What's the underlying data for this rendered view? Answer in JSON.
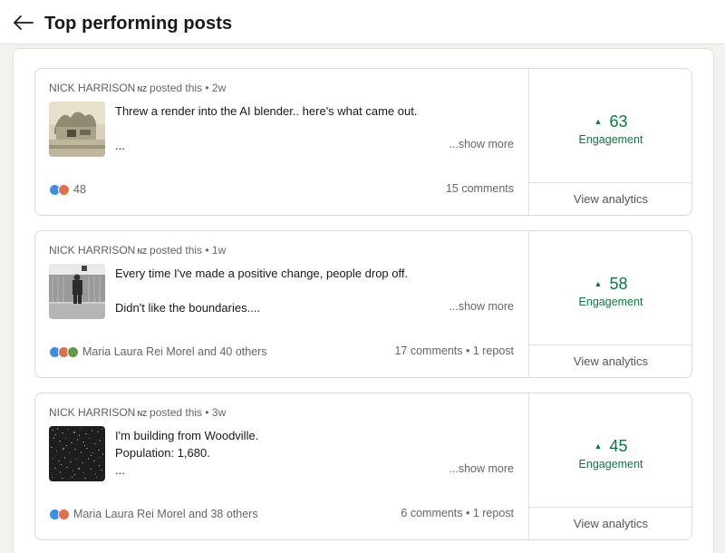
{
  "header": {
    "title": "Top performing posts",
    "back_icon": "arrow-left-icon"
  },
  "colors": {
    "engagement": "#0a7a3e",
    "like": "#378fe9",
    "love": "#df704d",
    "support": "#5f9b41"
  },
  "posts": [
    {
      "author": "NICK HARRISON",
      "badge": "NZ",
      "posted": "posted this • 2w",
      "lines": [
        "Threw a render into the AI blender.. here's what came out.",
        "",
        "..."
      ],
      "show_more": "...show more",
      "reactions_text": "48",
      "comments": "15 comments",
      "engagement_value": "63",
      "engagement_label": "Engagement",
      "analytics_label": "View analytics"
    },
    {
      "author": "NICK HARRISON",
      "badge": "NZ",
      "posted": "posted this • 1w",
      "lines": [
        "Every time I've made a positive change, people drop off.",
        "",
        "Didn't like the boundaries...."
      ],
      "show_more": "...show more",
      "reactions_text": "Maria Laura Rei Morel and 40 others",
      "comments": "17 comments • 1 repost",
      "engagement_value": "58",
      "engagement_label": "Engagement",
      "analytics_label": "View analytics"
    },
    {
      "author": "NICK HARRISON",
      "badge": "NZ",
      "posted": "posted this • 3w",
      "lines": [
        "I'm building from Woodville.",
        "Population: 1,680.",
        "..."
      ],
      "show_more": "...show more",
      "reactions_text": "Maria Laura Rei Morel and 38 others",
      "comments": "6 comments • 1 repost",
      "engagement_value": "45",
      "engagement_label": "Engagement",
      "analytics_label": "View analytics"
    }
  ]
}
